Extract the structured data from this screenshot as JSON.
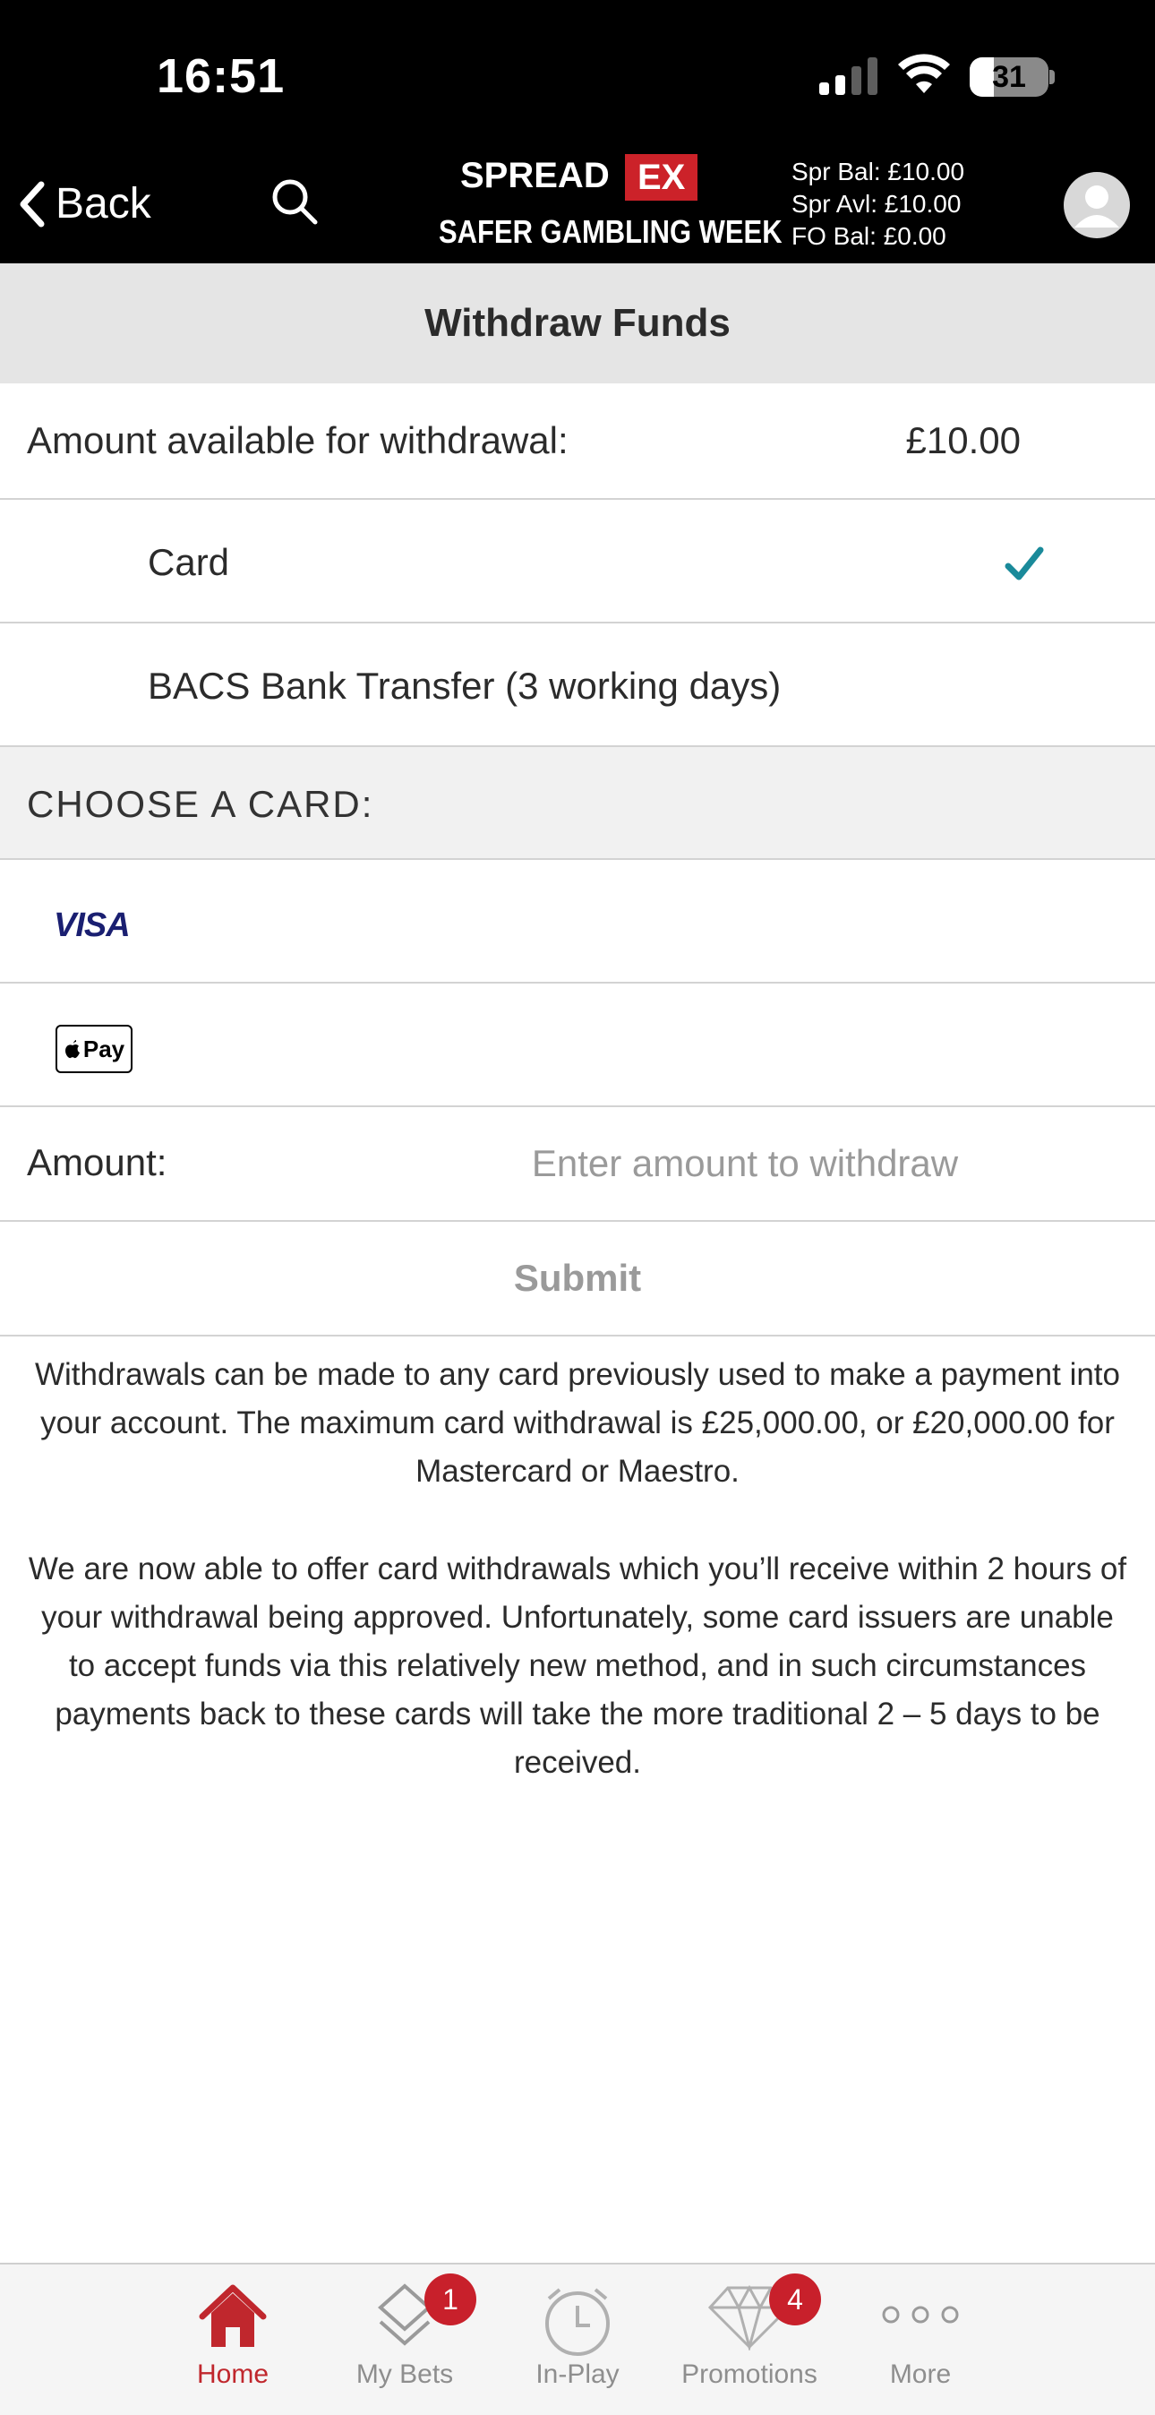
{
  "status_bar": {
    "time": "16:51",
    "battery": "31"
  },
  "header": {
    "back_label": "Back",
    "logo_text": "SPREAD",
    "logo_ex": "EX",
    "logo_sub": "SAFER GAMBLING WEEK",
    "balances": [
      "Spr Bal: £10.00",
      "Spr Avl: £10.00",
      "FO Bal: £0.00"
    ]
  },
  "page": {
    "title": "Withdraw Funds",
    "available_label": "Amount available for withdrawal:",
    "available_value": "£10.00",
    "methods": [
      {
        "label": "Card",
        "selected": true
      },
      {
        "label": "BACS Bank Transfer (3 working days)",
        "selected": false
      }
    ],
    "choose_card_label": "CHOOSE A CARD:",
    "cards": [
      {
        "brand": "VISA"
      },
      {
        "brand": "Pay"
      }
    ],
    "amount_label": "Amount:",
    "amount_placeholder": "Enter amount to withdraw",
    "amount_value": "",
    "submit_label": "Submit",
    "info_1": "Withdrawals can be made to any card previously used to make a payment into your account. The maximum card withdrawal is £25,000.00, or £20,000.00 for Mastercard or Maestro.",
    "info_2": "We are now able to offer card withdrawals which you’ll receive within 2 hours of your withdrawal being approved. Unfortunately, some card issuers are unable to accept funds via this relatively new method, and in such circumstances payments back to these cards will take the more traditional 2 – 5 days to be received."
  },
  "tabs": [
    {
      "label": "Home",
      "icon": "home-icon",
      "active": true
    },
    {
      "label": "My Bets",
      "icon": "my-bets-icon",
      "badge": "1"
    },
    {
      "label": "In-Play",
      "icon": "clock-icon"
    },
    {
      "label": "Promotions",
      "icon": "diamond-icon",
      "badge": "4"
    },
    {
      "label": "More",
      "icon": "more-dots-icon"
    }
  ],
  "colors": {
    "brand_red": "#cc2229",
    "check_teal": "#1a8a9a",
    "tab_active": "#c0272d"
  }
}
